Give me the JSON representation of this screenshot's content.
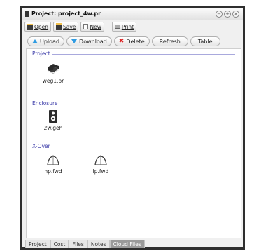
{
  "window": {
    "title": "Project: project_4w.pr"
  },
  "toolbar": {
    "open": "Open",
    "save": "Save",
    "new": "New",
    "print": "Print"
  },
  "actions": {
    "upload": "Upload",
    "download": "Download",
    "delete": "Delete",
    "refresh": "Refresh",
    "table": "Table"
  },
  "sections": {
    "project": {
      "label": "Project",
      "files": [
        "weg1.pr"
      ]
    },
    "enclosure": {
      "label": "Enclosure",
      "files": [
        "2w.geh"
      ]
    },
    "xover": {
      "label": "X-Over",
      "files": [
        "hp.fwd",
        "lp.fwd"
      ]
    }
  },
  "tabs": [
    "Project",
    "Cost",
    "Files",
    "Notes",
    "Cloud Files"
  ],
  "active_tab": "Cloud Files",
  "icons": [
    "window-icon",
    "open-icon",
    "save-icon",
    "new-icon",
    "print-icon",
    "upload-arrow-icon",
    "download-arrow-icon",
    "delete-x-icon",
    "book-icon",
    "speaker-icon",
    "filter-curve-icon"
  ]
}
